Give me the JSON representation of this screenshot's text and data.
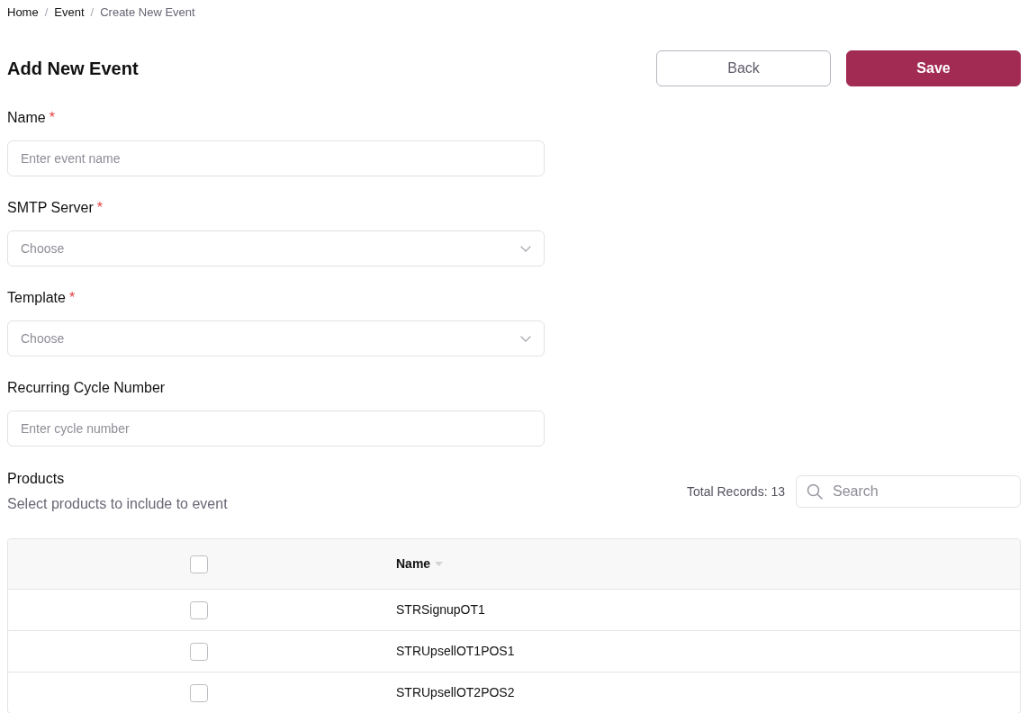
{
  "breadcrumb": {
    "separator": "/",
    "items": [
      {
        "label": "Home",
        "current": false
      },
      {
        "label": "Event",
        "current": false
      },
      {
        "label": "Create New Event",
        "current": true
      }
    ]
  },
  "page_title": "Add New Event",
  "buttons": [
    {
      "label": "Back",
      "kind": "outline"
    },
    {
      "label": "Save",
      "kind": "primary"
    }
  ],
  "fields": [
    {
      "label": "Name",
      "required_mark": "*",
      "kind": "text",
      "placeholder": "Enter event name"
    },
    {
      "label": "SMTP Server",
      "required_mark": "*",
      "kind": "select",
      "placeholder": "Choose"
    },
    {
      "label": "Template",
      "required_mark": "*",
      "kind": "select",
      "placeholder": "Choose"
    },
    {
      "label": "Recurring Cycle Number",
      "kind": "text",
      "placeholder": "Enter cycle number"
    }
  ],
  "products": {
    "title": "Products",
    "subtitle": "Select products to include to event",
    "total_records": "Total Records: 13",
    "search": {
      "placeholder": "Search"
    },
    "table": {
      "header": {
        "checked": false,
        "name_label": "Name"
      },
      "rows": [
        {
          "checked": false,
          "name": "STRSignupOT1"
        },
        {
          "checked": false,
          "name": "STRUpsellOT1POS1"
        },
        {
          "checked": false,
          "name": "STRUpsellOT2POS2"
        }
      ]
    }
  }
}
